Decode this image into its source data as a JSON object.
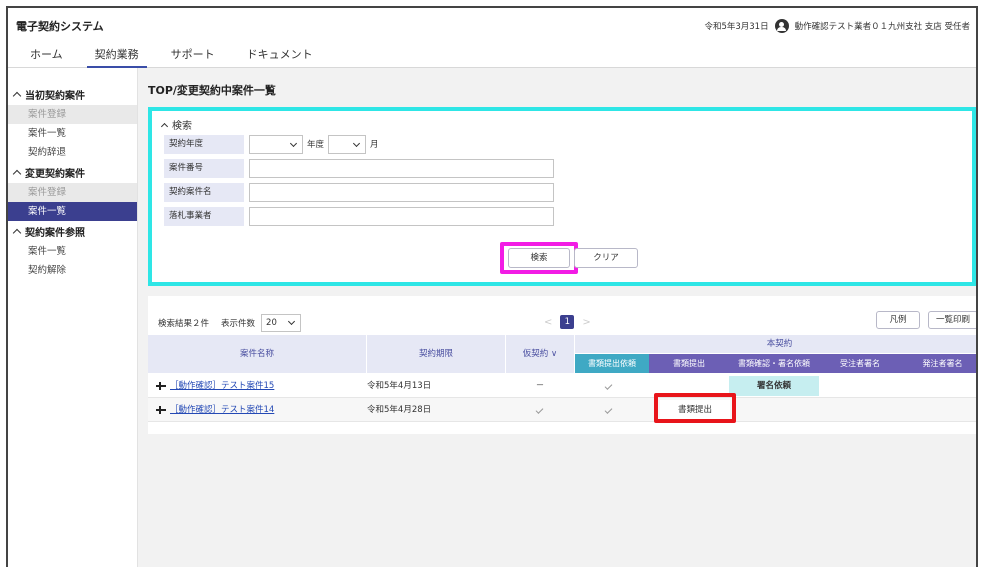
{
  "app": {
    "title": "電子契約システム"
  },
  "header": {
    "date": "令和5年3月31日",
    "user": "動作確認テスト業者０１九州支社 支店 受任者"
  },
  "nav": {
    "items": [
      "ホーム",
      "契約業務",
      "サポート",
      "ドキュメント"
    ],
    "active": "契約業務"
  },
  "sidebar": {
    "groups": [
      {
        "title": "当初契約案件",
        "items": [
          {
            "label": "案件登録",
            "state": "disabled"
          },
          {
            "label": "案件一覧",
            "state": "normal"
          },
          {
            "label": "契約辞退",
            "state": "normal"
          }
        ]
      },
      {
        "title": "変更契約案件",
        "items": [
          {
            "label": "案件登録",
            "state": "disabled"
          },
          {
            "label": "案件一覧",
            "state": "selected"
          }
        ]
      },
      {
        "title": "契約案件参照",
        "items": [
          {
            "label": "案件一覧",
            "state": "normal"
          },
          {
            "label": "契約解除",
            "state": "normal"
          }
        ]
      }
    ]
  },
  "page": {
    "title": "TOP/変更契約中案件一覧"
  },
  "search": {
    "heading": "検索",
    "fields": {
      "year_label": "契約年度",
      "year_unit": "年度",
      "month_unit": "月",
      "case_number_label": "案件番号",
      "case_name_label": "契約案件名",
      "bidder_label": "落札事業者"
    },
    "search_button": "検索",
    "clear_button": "クリア"
  },
  "results": {
    "count_label": "検索結果２件",
    "per_page_label": "表示件数",
    "per_page_value": "20",
    "current_page": "1",
    "legend_button": "凡例",
    "print_button": "一覧印刷",
    "columns": {
      "name": "案件名称",
      "period": "契約期限",
      "provisional": "仮契約 ∨",
      "main": "本契約"
    },
    "steps": [
      "書類提出依頼",
      "書類提出",
      "書類確認・署名依頼",
      "受注者署名",
      "発注者署名"
    ],
    "rows": [
      {
        "name": "［動作確認］テスト案件15",
        "period": "令和5年4月13日",
        "provisional": "－",
        "status": "署名依頼"
      },
      {
        "name": "［動作確認］テスト案件14",
        "period": "令和5年4月28日",
        "provisional": "✓",
        "status": "書類提出"
      }
    ]
  },
  "colors": {
    "accent": "#3b3f8f",
    "highlight_cyan": "#2ee6e6",
    "highlight_magenta": "#f21ce5",
    "highlight_red": "#e8141a",
    "step_teal": "#3fa9c4",
    "step_purple": "#6c5fb5"
  }
}
